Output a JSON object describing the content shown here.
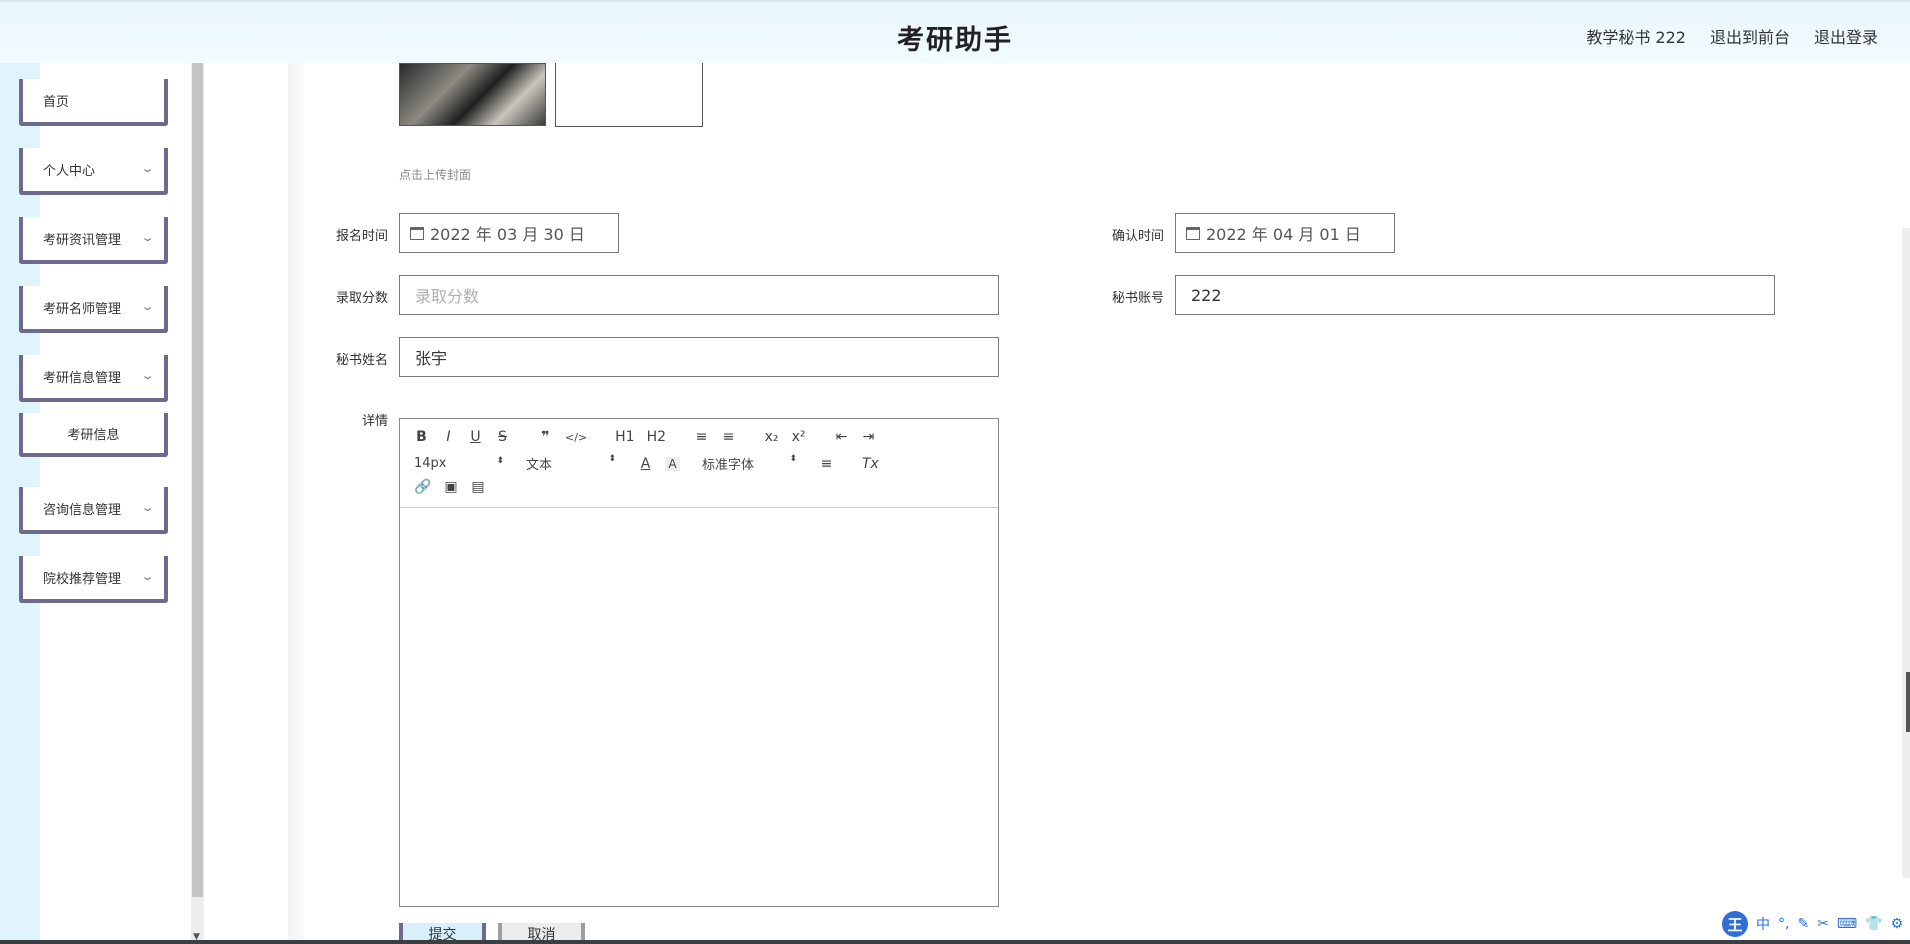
{
  "header": {
    "title": "考研助手",
    "user": "教学秘书 222",
    "back_to_front": "退出到前台",
    "logout": "退出登录"
  },
  "sidebar": {
    "items": [
      {
        "label": "首页"
      },
      {
        "label": "个人中心"
      },
      {
        "label": "考研资讯管理"
      },
      {
        "label": "考研名师管理"
      },
      {
        "label": "考研信息管理"
      },
      {
        "label": "考研信息"
      },
      {
        "label": "咨询信息管理"
      },
      {
        "label": "院校推荐管理"
      }
    ]
  },
  "form": {
    "cover_hint": "点击上传封面",
    "signup_time_label": "报名时间",
    "signup_time_value": "2022 年 03 月 30 日",
    "confirm_time_label": "确认时间",
    "confirm_time_value": "2022 年 04 月 01 日",
    "score_label": "录取分数",
    "score_placeholder": "录取分数",
    "secretary_account_label": "秘书账号",
    "secretary_account_value": "222",
    "secretary_name_label": "秘书姓名",
    "secretary_name_value": "张宇",
    "details_label": "详情",
    "submit_label": "提交",
    "cancel_label": "取消"
  },
  "editor": {
    "row1": [
      "B",
      "I",
      "U",
      "S",
      "❞",
      "</>",
      "H1",
      "H2",
      "≡",
      "≡",
      "x₂",
      "x²",
      "⇤",
      "⇥"
    ],
    "font_size": "14px",
    "format": "文本",
    "font_family": "标准字体",
    "align": "≡",
    "clear": "Tx"
  },
  "ime": {
    "logo": "王",
    "mode": "中"
  }
}
